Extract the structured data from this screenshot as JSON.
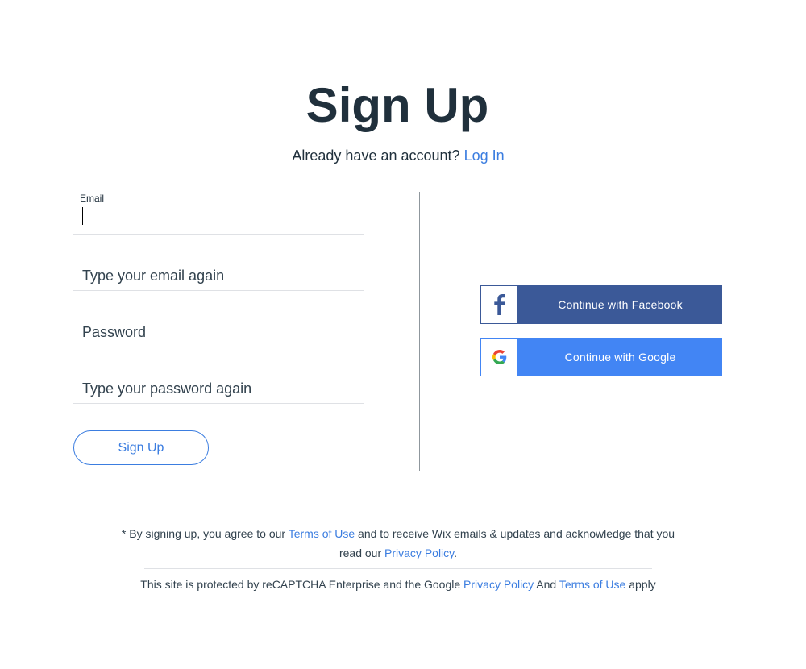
{
  "header": {
    "title": "Sign Up",
    "subtitle_text": "Already have an account?",
    "login_link": "Log In"
  },
  "form": {
    "email": {
      "label": "Email",
      "value": "",
      "placeholder": ""
    },
    "email_confirm": {
      "placeholder": "Type your email again",
      "value": ""
    },
    "password": {
      "placeholder": "Password",
      "value": ""
    },
    "password_confirm": {
      "placeholder": "Type your password again",
      "value": ""
    },
    "submit_label": "Sign Up"
  },
  "social": {
    "facebook": {
      "label": "Continue with Facebook",
      "icon": "facebook-icon",
      "color": "#3b5998"
    },
    "google": {
      "label": "Continue with Google",
      "icon": "google-icon",
      "color": "#4285f4"
    }
  },
  "legal": {
    "prefix": "* By signing up, you agree to our ",
    "terms_link": "Terms of Use",
    "middle": " and to receive Wix emails & updates and acknowledge that you read our ",
    "privacy_link": "Privacy Policy",
    "suffix": "."
  },
  "recaptcha": {
    "prefix": "This site is protected by reCAPTCHA Enterprise and the Google ",
    "privacy_link": "Privacy Policy",
    "middle": " And ",
    "terms_link": "Terms of Use",
    "suffix": " apply"
  },
  "colors": {
    "text": "#20303c",
    "link": "#3b7de0",
    "facebook": "#3b5998",
    "google": "#4285f4"
  }
}
